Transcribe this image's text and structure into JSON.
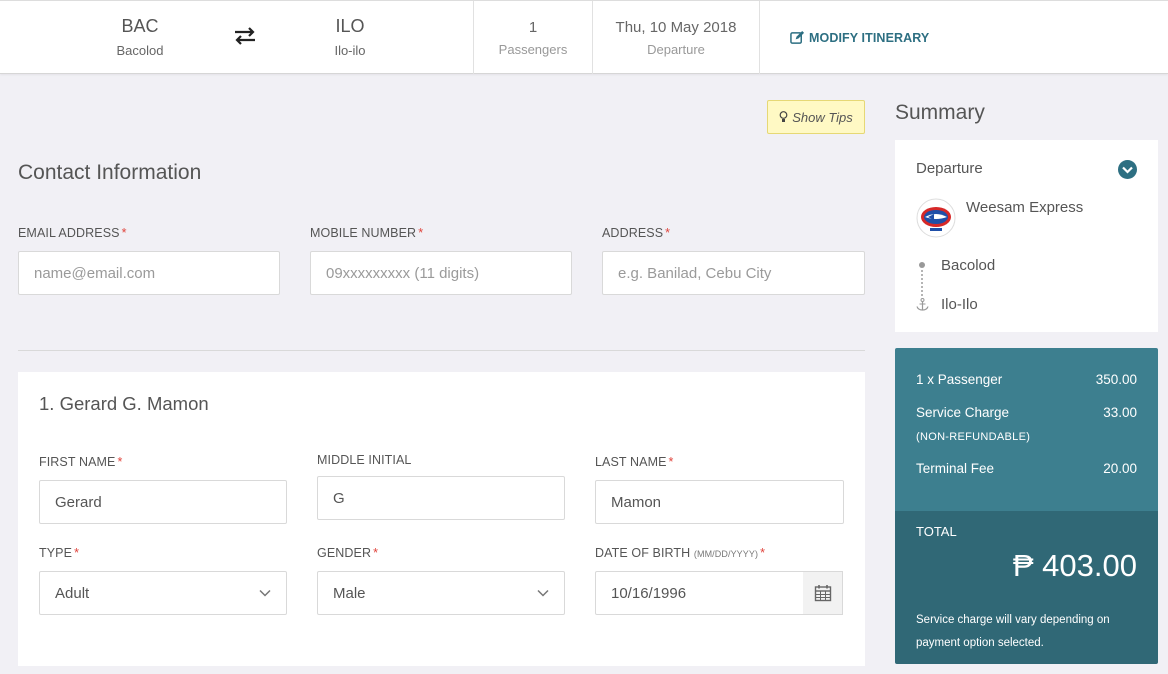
{
  "header": {
    "origin": {
      "code": "BAC",
      "name": "Bacolod"
    },
    "destination": {
      "code": "ILO",
      "name": "Ilo-ilo"
    },
    "passengers": {
      "value": "1",
      "label": "Passengers"
    },
    "departure": {
      "value": "Thu, 10 May 2018",
      "label": "Departure"
    },
    "modify_label": "MODIFY ITINERARY"
  },
  "tips_label": "Show Tips",
  "contact": {
    "title": "Contact Information",
    "email": {
      "label": "EMAIL ADDRESS",
      "placeholder": "name@email.com",
      "required": "*"
    },
    "mobile": {
      "label": "MOBILE NUMBER",
      "placeholder": "09xxxxxxxxx (11 digits)",
      "required": "*"
    },
    "address": {
      "label": "ADDRESS",
      "placeholder": "e.g. Banilad, Cebu City",
      "required": "*"
    }
  },
  "passenger": {
    "title": "1. Gerard G. Mamon",
    "first_name": {
      "label": "FIRST NAME",
      "value": "Gerard",
      "required": "*"
    },
    "middle_initial": {
      "label": "MIDDLE INITIAL",
      "value": "G"
    },
    "last_name": {
      "label": "LAST NAME",
      "value": "Mamon",
      "required": "*"
    },
    "type": {
      "label": "TYPE",
      "value": "Adult",
      "required": "*"
    },
    "gender": {
      "label": "GENDER",
      "value": "Male",
      "required": "*"
    },
    "dob": {
      "label": "DATE OF BIRTH",
      "label_sub": "(MM/DD/YYYY)",
      "value": "10/16/1996",
      "required": "*"
    }
  },
  "summary": {
    "title": "Summary",
    "departure_label": "Departure",
    "operator": "Weesam Express",
    "from": "Bacolod",
    "to": "Ilo-Ilo",
    "fares": [
      {
        "label": "1 x Passenger",
        "value": "350.00"
      },
      {
        "label": "Service Charge",
        "sub": "(NON-REFUNDABLE)",
        "value": "33.00"
      },
      {
        "label": "Terminal Fee",
        "value": "20.00"
      }
    ],
    "total_label": "TOTAL",
    "total_amount": "₱ 403.00",
    "note": "Service charge will vary depending on payment option selected."
  },
  "colors": {
    "accent": "#2d6f82",
    "fare_bg": "#3d7f8f",
    "total_bg": "#306876",
    "required": "#e0443c",
    "tips_bg": "#fff9c4"
  }
}
